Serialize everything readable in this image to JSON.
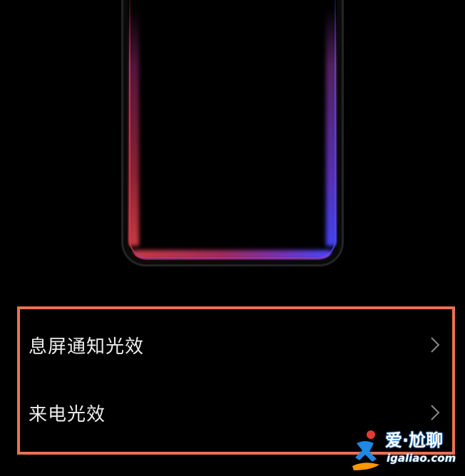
{
  "settings": {
    "items": [
      {
        "label": "息屏通知光效"
      },
      {
        "label": "来电光效"
      }
    ]
  },
  "watermark": {
    "brand": "爱·尬聊",
    "domain": "igaliao.com"
  },
  "colors": {
    "background": "#000000",
    "highlight_frame": "#e8734f",
    "label_text": "#ededed",
    "chevron": "#8a8a8a",
    "glow_red": "#d23c46",
    "glow_blue": "#4646ff"
  },
  "icons": {
    "row_arrow": "chevron-right-icon",
    "watermark_logo": "running-figure-logo"
  }
}
